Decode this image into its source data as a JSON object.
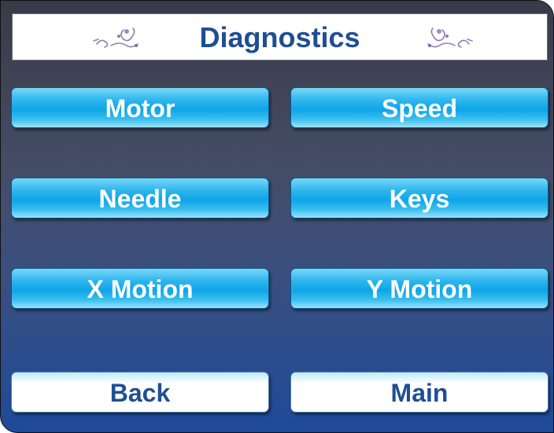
{
  "header": {
    "title": "Diagnostics",
    "ornament_left_icon": "floral-ornament-icon",
    "ornament_right_icon": "floral-ornament-icon"
  },
  "menu": {
    "motor_label": "Motor",
    "speed_label": "Speed",
    "needle_label": "Needle",
    "keys_label": "Keys",
    "x_motion_label": "X Motion",
    "y_motion_label": "Y Motion"
  },
  "nav": {
    "back_label": "Back",
    "main_label": "Main"
  },
  "colors": {
    "title_text": "#1f4e94",
    "menu_button": "#0ea5e8",
    "nav_button": "#ffffff"
  }
}
